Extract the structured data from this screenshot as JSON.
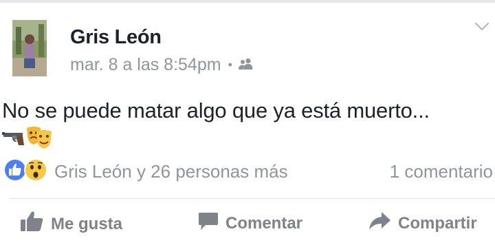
{
  "post": {
    "author": "Gris León",
    "timestamp": "mar. 8 a las 8:54pm",
    "separator": "•",
    "audience_icon": "friends-icon",
    "text": "No se puede matar algo que ya está muerto...",
    "emojis": [
      "pistol-emoji",
      "theater-masks-emoji"
    ]
  },
  "reactions": {
    "icons": [
      "like-reaction-icon",
      "wow-reaction-icon"
    ],
    "names": "Gris León y 26 personas más",
    "comments": "1 comentario"
  },
  "actions": {
    "like": "Me gusta",
    "comment": "Comentar",
    "share": "Compartir"
  },
  "colors": {
    "like_blue": "#4f7df2",
    "wow_yellow": "#f7c843",
    "secondary_text": "#90949c",
    "action_gray": "#7f8389"
  }
}
